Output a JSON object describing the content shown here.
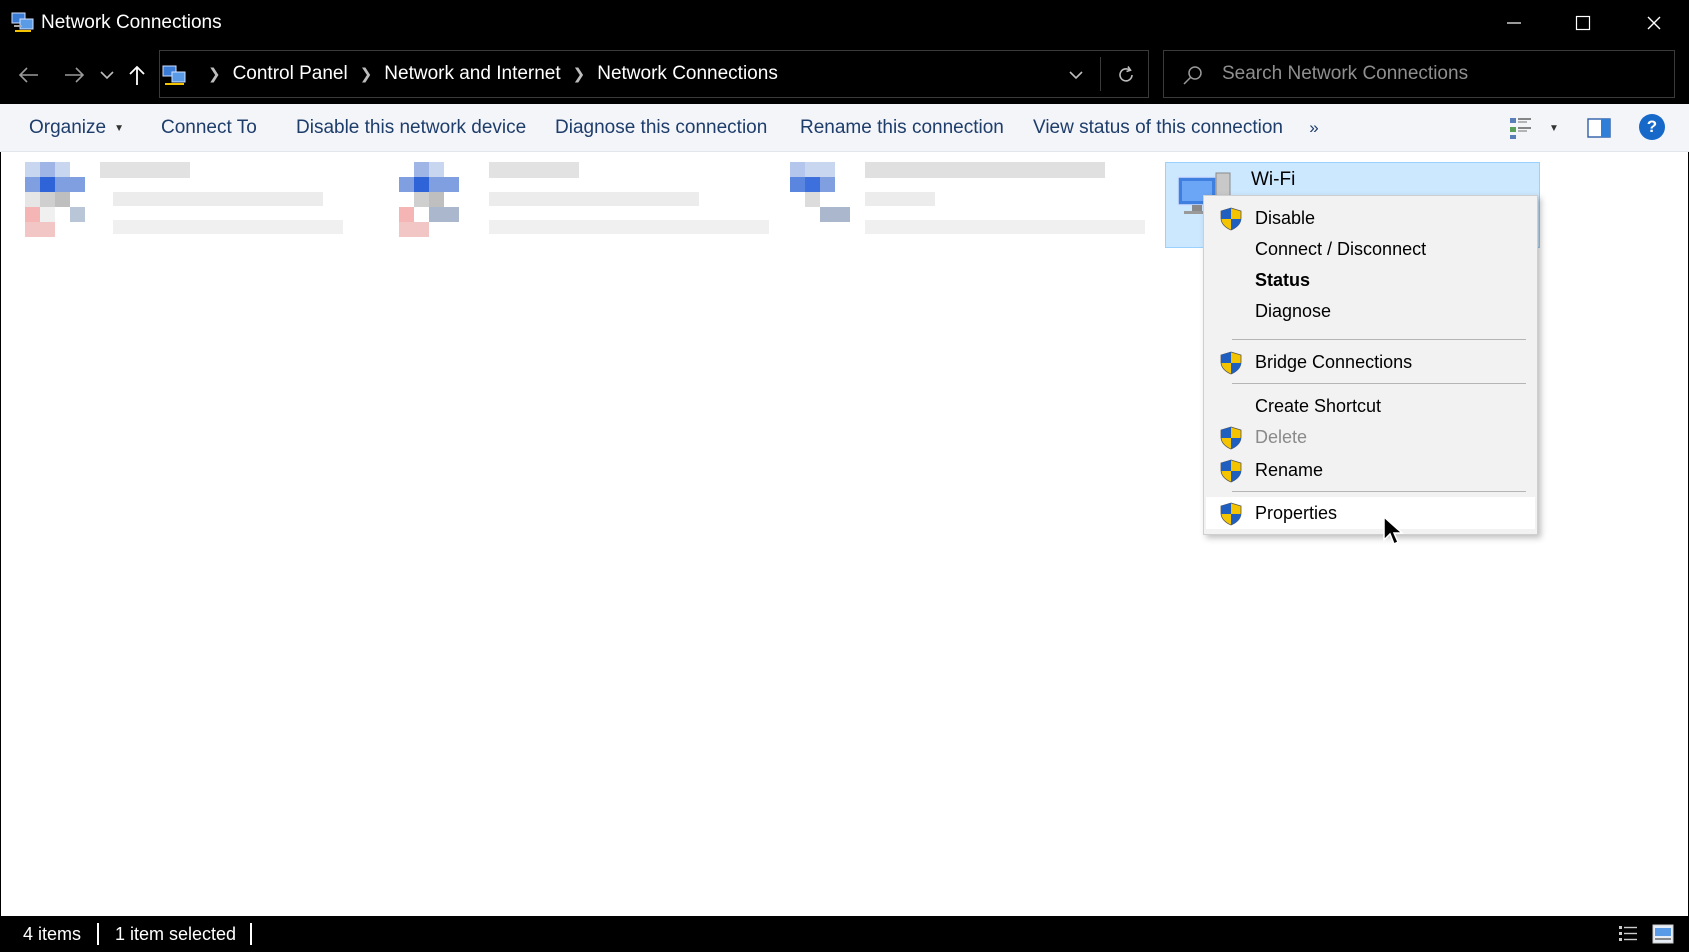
{
  "window": {
    "title": "Network Connections",
    "controls": [
      "minimize-icon",
      "maximize-icon",
      "close-icon"
    ]
  },
  "address": {
    "breadcrumbs": [
      "Control Panel",
      "Network and Internet",
      "Network Connections"
    ]
  },
  "search": {
    "placeholder": "Search Network Connections"
  },
  "commands": {
    "organize": "Organize",
    "connect_to": "Connect To",
    "disable_device": "Disable this network device",
    "diagnose": "Diagnose this connection",
    "rename": "Rename this connection",
    "view_status": "View status of this connection",
    "more": "»",
    "help": "?"
  },
  "connections": {
    "selected_name": "Wi-Fi"
  },
  "context_menu": {
    "disable": "Disable",
    "connect_disconnect": "Connect / Disconnect",
    "status": "Status",
    "diagnose": "Diagnose",
    "bridge": "Bridge Connections",
    "create_shortcut": "Create Shortcut",
    "delete": "Delete",
    "rename": "Rename",
    "properties": "Properties"
  },
  "status_bar": {
    "item_count": "4 items",
    "selection": "1 item selected"
  },
  "colors": {
    "titlebar_bg": "#000000",
    "command_text": "#1e3d6b",
    "selection_bg": "#cce8ff",
    "selection_border": "#99d1ff",
    "menu_bg": "#f2f2f2",
    "shield_blue": "#1f5fbf",
    "shield_yellow": "#f5c400"
  }
}
